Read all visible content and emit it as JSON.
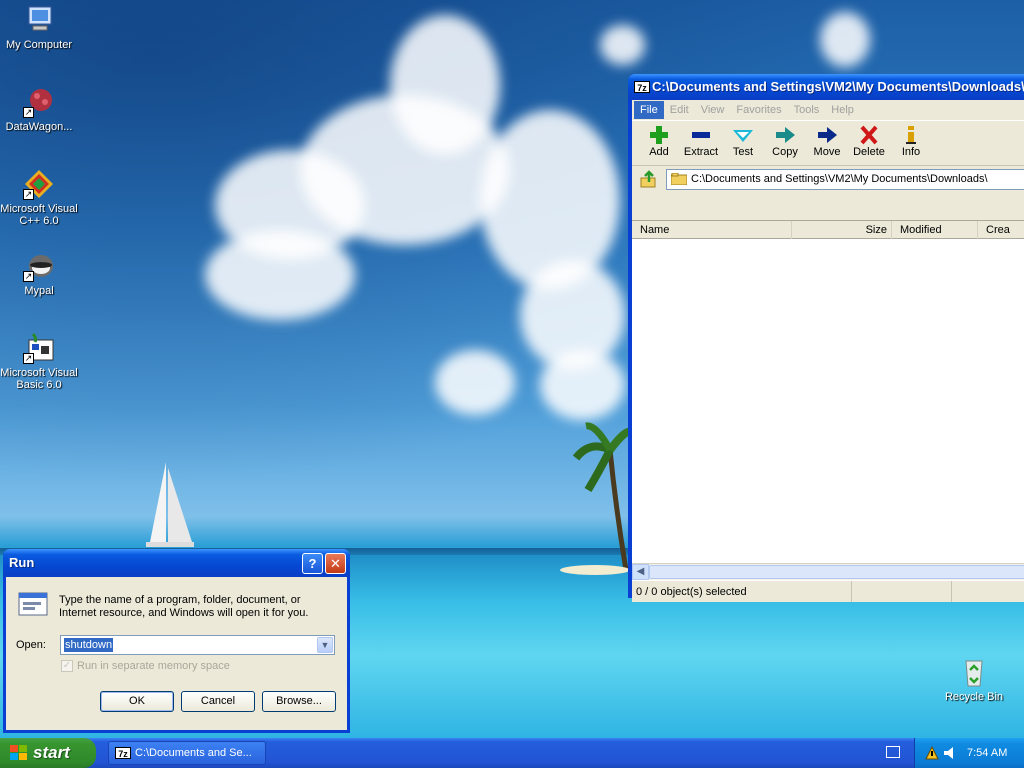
{
  "desktop": {
    "icons": [
      {
        "label": "My Computer"
      },
      {
        "label": "DataWagon..."
      },
      {
        "label": "Microsoft Visual C++ 6.0"
      },
      {
        "label": "Mypal"
      },
      {
        "label": "Microsoft Visual Basic 6.0"
      },
      {
        "label": "Recycle Bin"
      }
    ]
  },
  "zip_window": {
    "app_badge": "7z",
    "title": "C:\\Documents and Settings\\VM2\\My Documents\\Downloads\\",
    "menu": [
      "File",
      "Edit",
      "View",
      "Favorites",
      "Tools",
      "Help"
    ],
    "toolbar": [
      {
        "label": "Add",
        "icon": "plus-icon",
        "color": "#1ea01e"
      },
      {
        "label": "Extract",
        "icon": "minus-icon",
        "color": "#0a2a9a"
      },
      {
        "label": "Test",
        "icon": "check-icon",
        "color": "#19b8d8"
      },
      {
        "label": "Copy",
        "icon": "arrow-right-icon",
        "color": "#1a8a8a"
      },
      {
        "label": "Move",
        "icon": "arrow-right-icon",
        "color": "#0a2a8a"
      },
      {
        "label": "Delete",
        "icon": "x-icon",
        "color": "#d01818"
      },
      {
        "label": "Info",
        "icon": "info-icon",
        "color": "#d8a000"
      }
    ],
    "address": "C:\\Documents and Settings\\VM2\\My Documents\\Downloads\\",
    "columns": [
      "Name",
      "Size",
      "Modified",
      "Crea"
    ],
    "status": {
      "selection": "0 / 0 object(s) selected",
      "cell2": "",
      "cell3": "",
      "cell4": ""
    }
  },
  "run_dialog": {
    "title": "Run",
    "help_label": "?",
    "close_label": "✕",
    "description": "Type the name of a program, folder, document, or Internet resource, and Windows will open it for you.",
    "open_label": "Open:",
    "input_value": "shutdown",
    "separate_memory_label": "Run in separate memory space",
    "ok_label": "OK",
    "cancel_label": "Cancel",
    "browse_label": "Browse..."
  },
  "taskbar": {
    "start_label": "start",
    "task_badge": "7z",
    "task_label": "C:\\Documents and Se...",
    "clock": "7:54 AM"
  },
  "colors": {
    "xp_blue": "#0a3fd3",
    "start_green": "#37952f",
    "selection": "#316ac5"
  }
}
